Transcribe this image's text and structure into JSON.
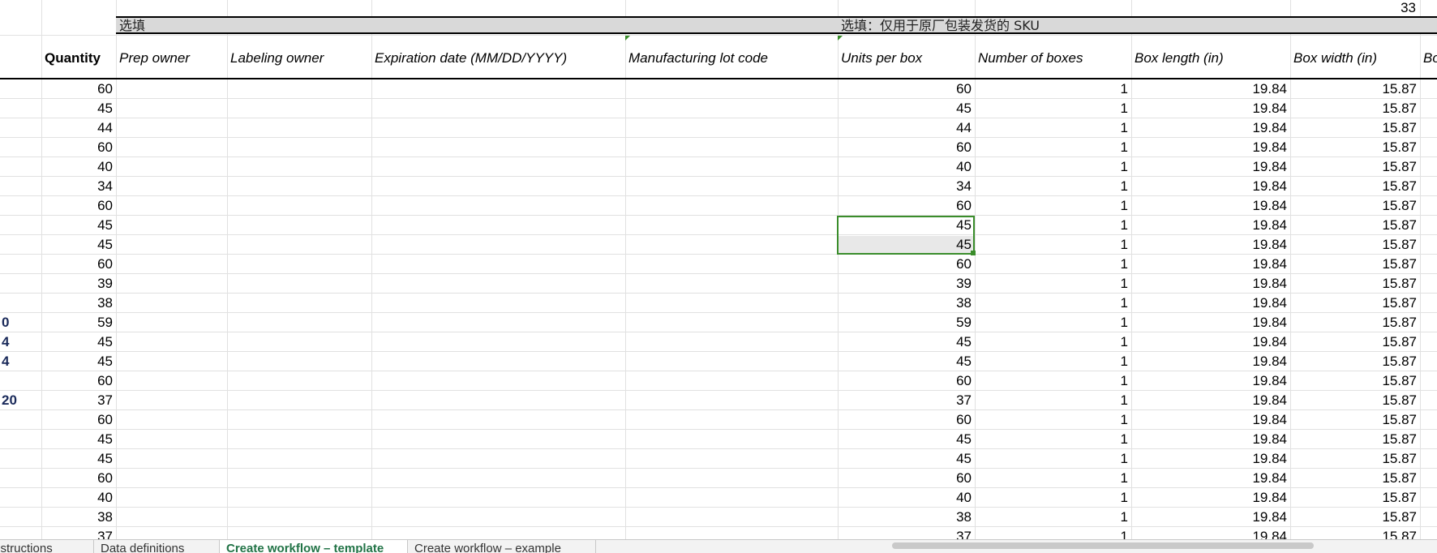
{
  "top_right_number": "33",
  "group_headers": {
    "optional": "选填",
    "optional_sku": "选填：仅用于原厂包装发货的 SKU"
  },
  "column_headers": {
    "quantity": "Quantity",
    "prep_owner": "Prep owner",
    "labeling_owner": "Labeling owner",
    "expiration_date": "Expiration date (MM/DD/YYYY)",
    "lot_code": "Manufacturing lot code",
    "units_per_box": "Units per box",
    "number_of_boxes": "Number of boxes",
    "box_length": "Box length (in)",
    "box_width": "Box width (in)",
    "box_next_partial": "Bo"
  },
  "left_edge_fragments": [
    "",
    "",
    "",
    "",
    "",
    "",
    "",
    "",
    "",
    "",
    "",
    "",
    "0",
    "4",
    "4",
    "",
    "20",
    "",
    "",
    "",
    "",
    "",
    "",
    ""
  ],
  "rows": [
    {
      "quantity": "60",
      "units_per_box": "60",
      "boxes": "1",
      "length": "19.84",
      "width": "15.87"
    },
    {
      "quantity": "45",
      "units_per_box": "45",
      "boxes": "1",
      "length": "19.84",
      "width": "15.87"
    },
    {
      "quantity": "44",
      "units_per_box": "44",
      "boxes": "1",
      "length": "19.84",
      "width": "15.87"
    },
    {
      "quantity": "60",
      "units_per_box": "60",
      "boxes": "1",
      "length": "19.84",
      "width": "15.87"
    },
    {
      "quantity": "40",
      "units_per_box": "40",
      "boxes": "1",
      "length": "19.84",
      "width": "15.87"
    },
    {
      "quantity": "34",
      "units_per_box": "34",
      "boxes": "1",
      "length": "19.84",
      "width": "15.87"
    },
    {
      "quantity": "60",
      "units_per_box": "60",
      "boxes": "1",
      "length": "19.84",
      "width": "15.87"
    },
    {
      "quantity": "45",
      "units_per_box": "45",
      "boxes": "1",
      "length": "19.84",
      "width": "15.87"
    },
    {
      "quantity": "45",
      "units_per_box": "45",
      "boxes": "1",
      "length": "19.84",
      "width": "15.87"
    },
    {
      "quantity": "60",
      "units_per_box": "60",
      "boxes": "1",
      "length": "19.84",
      "width": "15.87"
    },
    {
      "quantity": "39",
      "units_per_box": "39",
      "boxes": "1",
      "length": "19.84",
      "width": "15.87"
    },
    {
      "quantity": "38",
      "units_per_box": "38",
      "boxes": "1",
      "length": "19.84",
      "width": "15.87"
    },
    {
      "quantity": "59",
      "units_per_box": "59",
      "boxes": "1",
      "length": "19.84",
      "width": "15.87"
    },
    {
      "quantity": "45",
      "units_per_box": "45",
      "boxes": "1",
      "length": "19.84",
      "width": "15.87"
    },
    {
      "quantity": "45",
      "units_per_box": "45",
      "boxes": "1",
      "length": "19.84",
      "width": "15.87"
    },
    {
      "quantity": "60",
      "units_per_box": "60",
      "boxes": "1",
      "length": "19.84",
      "width": "15.87"
    },
    {
      "quantity": "37",
      "units_per_box": "37",
      "boxes": "1",
      "length": "19.84",
      "width": "15.87"
    },
    {
      "quantity": "60",
      "units_per_box": "60",
      "boxes": "1",
      "length": "19.84",
      "width": "15.87"
    },
    {
      "quantity": "45",
      "units_per_box": "45",
      "boxes": "1",
      "length": "19.84",
      "width": "15.87"
    },
    {
      "quantity": "45",
      "units_per_box": "45",
      "boxes": "1",
      "length": "19.84",
      "width": "15.87"
    },
    {
      "quantity": "60",
      "units_per_box": "60",
      "boxes": "1",
      "length": "19.84",
      "width": "15.87"
    },
    {
      "quantity": "40",
      "units_per_box": "40",
      "boxes": "1",
      "length": "19.84",
      "width": "15.87"
    },
    {
      "quantity": "38",
      "units_per_box": "38",
      "boxes": "1",
      "length": "19.84",
      "width": "15.87"
    },
    {
      "quantity": "37",
      "units_per_box": "37",
      "boxes": "1",
      "length": "19.84",
      "width": "15.87"
    }
  ],
  "sheet_tabs": [
    {
      "label": "Instructions",
      "active": false
    },
    {
      "label": "Data definitions",
      "active": false
    },
    {
      "label": "Create workflow – template",
      "active": true
    },
    {
      "label": "Create workflow – example",
      "active": false
    }
  ],
  "colors": {
    "selection": "#3a8d2b",
    "group_band": "#d9d9d9",
    "active_tab": "#217346"
  }
}
